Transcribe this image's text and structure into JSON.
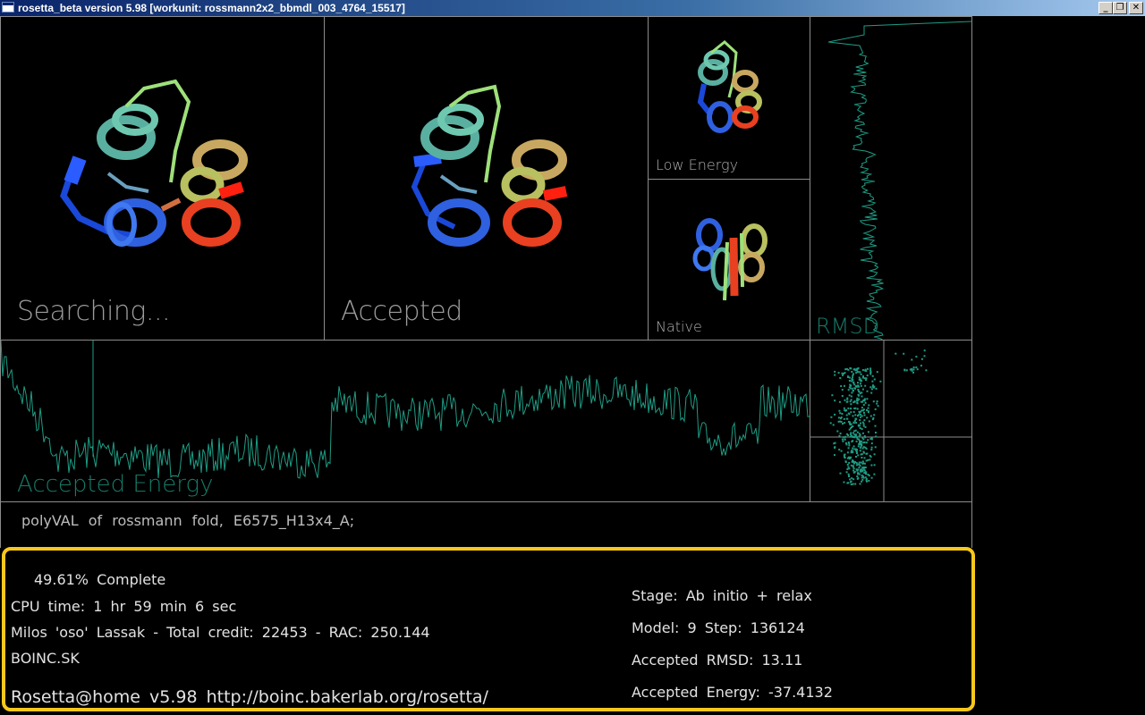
{
  "window": {
    "title": "rosetta_beta version 5.98 [workunit: rossmann2x2_bbmdl_003_4764_15517]",
    "buttons": {
      "minimize": "_",
      "restore": "❐",
      "close": "✕"
    }
  },
  "panels": {
    "searching_label": "Searching...",
    "accepted_label": "Accepted",
    "low_energy_label": "Low  Energy",
    "native_label": "Native",
    "rmsd_label": "RMSD",
    "accepted_energy_label": "Accepted  Energy"
  },
  "description": "polyVAL of rossmann fold, E6575_H13x4_A;",
  "status": {
    "complete": "49.61% Complete",
    "cpu_time": "CPU time: 1 hr 59 min 6 sec",
    "user_credit": "Milos 'oso' Lassak - Total credit: 22453 - RAC: 250.144",
    "team": "BOINC.SK",
    "app_info": "Rosetta@home v5.98 http://boinc.bakerlab.org/rosetta/",
    "stage": "Stage: Ab initio + relax",
    "model_step": "Model: 9   Step: 136124",
    "accepted_rmsd": "Accepted RMSD:   13.11",
    "accepted_energy": "Accepted Energy: -37.4132"
  },
  "colors": {
    "trace": "#1e9c84",
    "highlight": "#f7c81c",
    "border": "#8c8c8c"
  }
}
